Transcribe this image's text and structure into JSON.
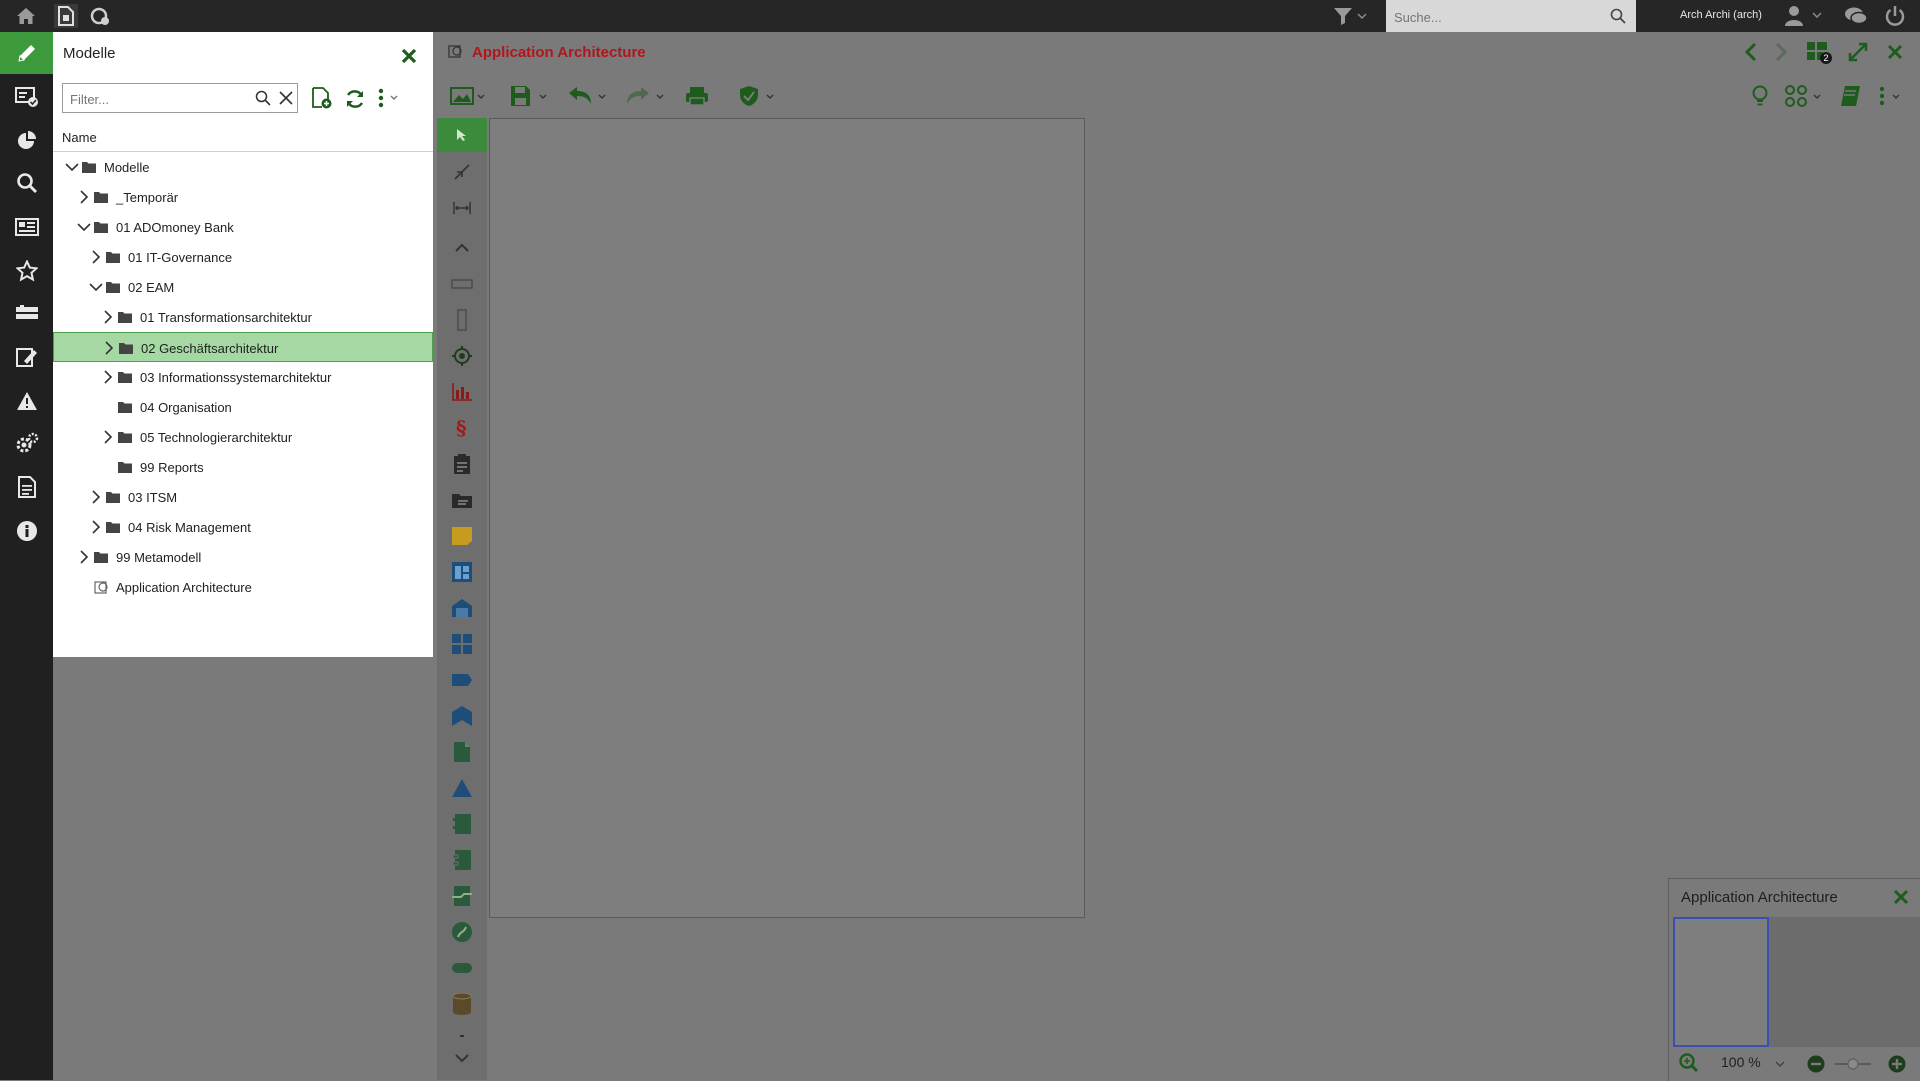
{
  "colors": {
    "accent_green": "#1d6b1d",
    "active_green": "#3c9a3c",
    "selection": "#a6d8a4",
    "title_red": "#b0161c",
    "topbar": "#262626",
    "rail": "#202020",
    "workspace": "#7a7a7a"
  },
  "topbar": {
    "search_placeholder": "Suche...",
    "user": "Arch Archi (arch)",
    "icons": [
      "home-icon",
      "new-model-icon",
      "refresh-model-icon",
      "filter-icon",
      "search-icon",
      "user-icon",
      "chat-icon",
      "power-icon"
    ]
  },
  "rail": {
    "items": [
      {
        "name": "modeling",
        "icon": "pencil-icon",
        "active": true
      },
      {
        "name": "analysis",
        "icon": "analysis-icon"
      },
      {
        "name": "charts",
        "icon": "pie-chart-icon"
      },
      {
        "name": "search",
        "icon": "search-icon"
      },
      {
        "name": "reports",
        "icon": "newspaper-icon"
      },
      {
        "name": "favorites",
        "icon": "star-icon"
      },
      {
        "name": "components",
        "icon": "components-icon"
      },
      {
        "name": "release",
        "icon": "release-icon"
      },
      {
        "name": "warnings",
        "icon": "warning-icon"
      },
      {
        "name": "settings",
        "icon": "gears-icon"
      },
      {
        "name": "documents",
        "icon": "document-icon"
      },
      {
        "name": "info",
        "icon": "info-icon"
      }
    ]
  },
  "panel": {
    "title": "Modelle",
    "filter_placeholder": "Filter...",
    "column_name": "Name",
    "tree": [
      {
        "label": "Modelle",
        "level": 0,
        "chevron": "down",
        "folder": true
      },
      {
        "label": "_Temporär",
        "level": 1,
        "chevron": "right",
        "folder": true
      },
      {
        "label": "01 ADOmoney Bank",
        "level": 1,
        "chevron": "down",
        "folder": true
      },
      {
        "label": "01 IT-Governance",
        "level": 2,
        "chevron": "right",
        "folder": true
      },
      {
        "label": "02 EAM",
        "level": 2,
        "chevron": "down",
        "folder": true
      },
      {
        "label": "01 Transformationsarchitektur",
        "level": 3,
        "chevron": "right",
        "folder": true
      },
      {
        "label": "02 Geschäftsarchitektur",
        "level": 3,
        "chevron": "right",
        "folder": true,
        "selected": true
      },
      {
        "label": "03 Informationssystemarchitektur",
        "level": 3,
        "chevron": "right",
        "folder": true
      },
      {
        "label": "04 Organisation",
        "level": 3,
        "chevron": "none",
        "folder": true
      },
      {
        "label": "05 Technologierarchitektur",
        "level": 3,
        "chevron": "right",
        "folder": true
      },
      {
        "label": "99 Reports",
        "level": 3,
        "chevron": "none",
        "folder": true
      },
      {
        "label": "03 ITSM",
        "level": 2,
        "chevron": "right",
        "folder": true
      },
      {
        "label": "04 Risk Management",
        "level": 2,
        "chevron": "right",
        "folder": true
      },
      {
        "label": "99 Metamodell",
        "level": 1,
        "chevron": "right",
        "folder": true
      },
      {
        "label": "Application Architecture",
        "level": 1,
        "chevron": "none",
        "folder": false
      }
    ]
  },
  "workspace": {
    "title": "Application Architecture",
    "open_models_count": "2"
  },
  "overview": {
    "title": "Application Architecture",
    "zoom": "100 %"
  }
}
